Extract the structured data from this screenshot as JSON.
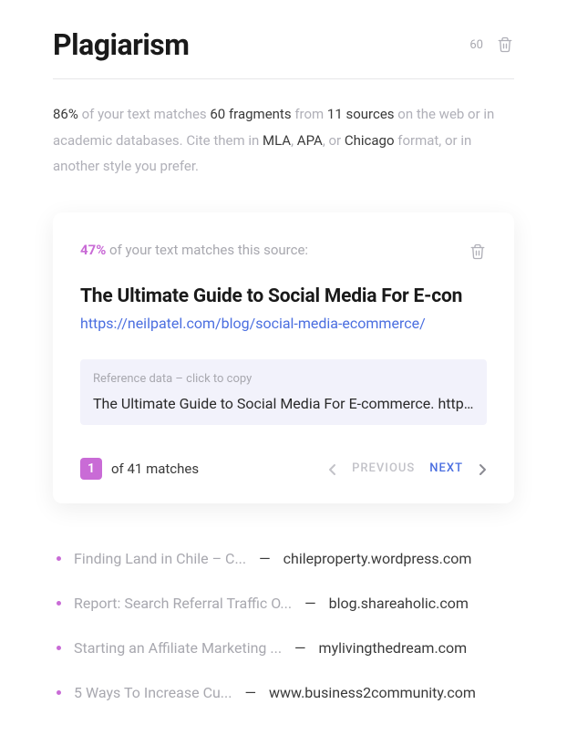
{
  "header": {
    "title": "Plagiarism",
    "count": "60"
  },
  "summary": {
    "pct": "86%",
    "mid1": " of your text matches ",
    "frag": "60 fragments",
    "mid2": " from ",
    "src": "11 sources",
    "tail1": " on the web or in academic databases. Cite them in ",
    "mla": "MLA",
    "sep1": ", ",
    "apa": "APA",
    "sep2": ", or ",
    "chi": "Chicago",
    "tail2": " format, or in another style you prefer."
  },
  "card": {
    "pct": "47%",
    "match_text": " of your text matches this source:",
    "title": "The Ultimate Guide to Social Media For E-con",
    "url": "https://neilpatel.com/blog/social-media-ecommerce/",
    "ref_label": "Reference data – click to copy",
    "ref_text": "The Ultimate Guide to Social Media For E-commerce. https://..."
  },
  "pager": {
    "current": "1",
    "total_label": "of 41 matches",
    "prev": "PREVIOUS",
    "next": "NEXT"
  },
  "sources": [
    {
      "title": "Finding Land in Chile – C...",
      "domain": "chileproperty.wordpress.com"
    },
    {
      "title": "Report: Search Referral Traffic O...",
      "domain": "blog.shareaholic.com"
    },
    {
      "title": "Starting an Affiliate Marketing ...",
      "domain": "mylivingthedream.com"
    },
    {
      "title": "5 Ways To Increase Cu...",
      "domain": "www.business2community.com"
    }
  ],
  "dash": "—"
}
